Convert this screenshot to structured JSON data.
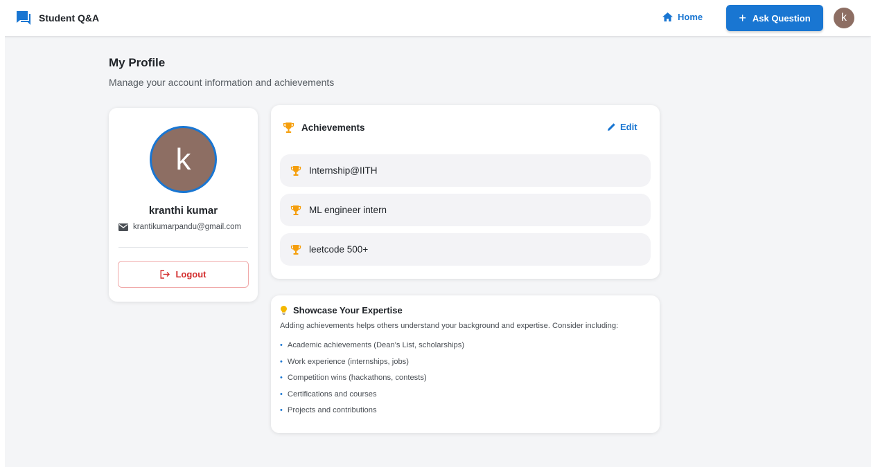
{
  "app": {
    "title": "Student Q&A"
  },
  "nav": {
    "home_label": "Home",
    "ask_label": "Ask Question",
    "avatar_initial": "k"
  },
  "colors": {
    "primary": "#1976d2",
    "avatar": "#8d6e63",
    "trophy": "#f59e0b",
    "danger": "#d32f2f",
    "background": "#f4f5f7"
  },
  "page": {
    "title": "My Profile",
    "subtitle": "Manage your account information and achievements"
  },
  "profile": {
    "initial": "k",
    "name": "kranthi kumar",
    "email": "krantikumarpandu@gmail.com",
    "logout_label": "Logout"
  },
  "achievements": {
    "title": "Achievements",
    "edit_label": "Edit",
    "items": [
      "Internship@IITH",
      "ML engineer intern",
      "leetcode 500+"
    ]
  },
  "tips": {
    "title": "Showcase Your Expertise",
    "description": "Adding achievements helps others understand your background and expertise. Consider including:",
    "items": [
      "Academic achievements (Dean's List, scholarships)",
      "Work experience (internships, jobs)",
      "Competition wins (hackathons, contests)",
      "Certifications and courses",
      "Projects and contributions"
    ]
  },
  "icons": {
    "brand": "forum-icon",
    "home": "home-icon",
    "email": "mail-icon",
    "logout": "logout-icon",
    "trophy": "trophy-icon",
    "edit": "pencil-icon",
    "tips": "lightbulb-icon"
  }
}
